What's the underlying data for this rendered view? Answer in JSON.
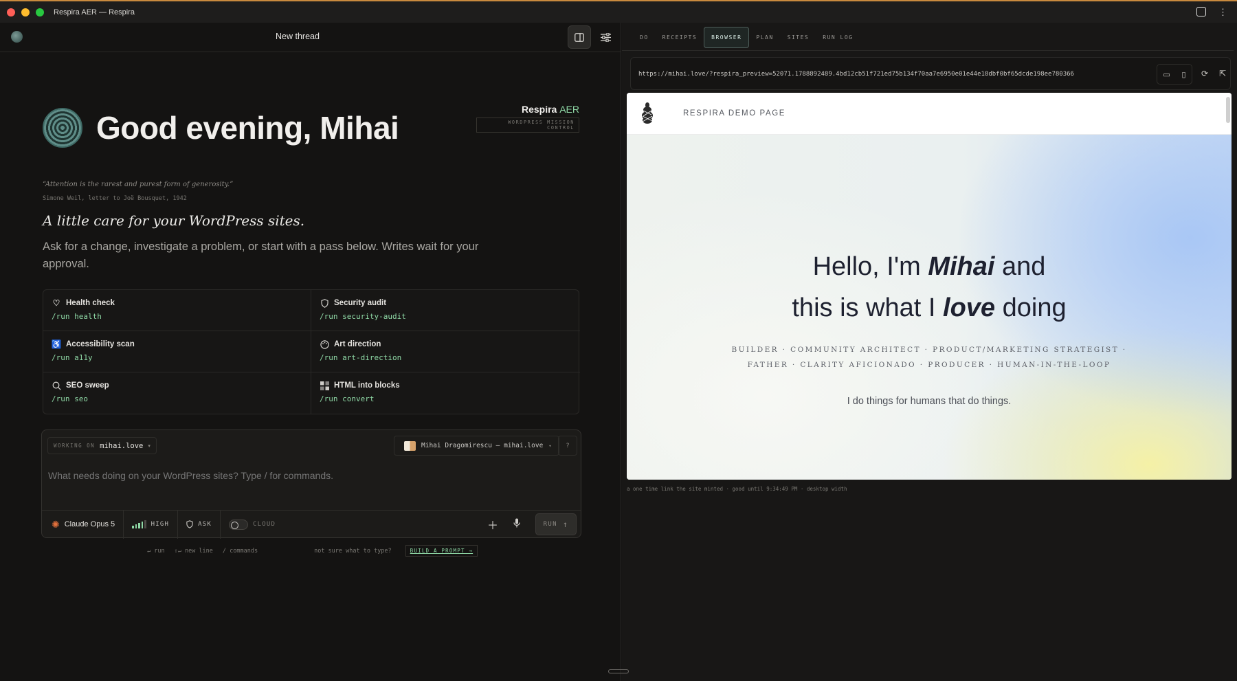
{
  "window": {
    "title": "Respira AER — Respira"
  },
  "left": {
    "thread_title": "New thread",
    "greeting": "Good evening, Mihai",
    "brand": {
      "name": "Respira",
      "suffix": "AER",
      "tagline": "WORDPRESS MISSION CONTROL"
    },
    "quote": "“Attention is the rarest and purest form of generosity.”",
    "attribution": "Simone Weil, letter to Joë Bousquet, 1942",
    "care_line": "A little care for your WordPress sites.",
    "lede": "Ask for a change, investigate a problem, or start with a pass below. Writes wait for your approval.",
    "cards": [
      {
        "title": "Health check",
        "command": "/run health",
        "icon": "heart-pulse-icon"
      },
      {
        "title": "Security audit",
        "command": "/run security-audit",
        "icon": "shield-icon"
      },
      {
        "title": "Accessibility scan",
        "command": "/run a11y",
        "icon": "accessibility-icon"
      },
      {
        "title": "Art direction",
        "command": "/run art-direction",
        "icon": "palette-icon"
      },
      {
        "title": "SEO sweep",
        "command": "/run seo",
        "icon": "search-icon"
      },
      {
        "title": "HTML into blocks",
        "command": "/run convert",
        "icon": "blocks-icon"
      }
    ],
    "composer": {
      "working_label": "WORKING ON",
      "working_value": "mihai.love",
      "account": "Mihai Dragomirescu — mihai.love",
      "help": "?",
      "placeholder": "What needs doing on your WordPress sites? Type / for commands.",
      "model": "Claude Opus 5",
      "effort": "HIGH",
      "mode": "ASK",
      "cloud": "CLOUD",
      "run": "RUN"
    },
    "hints": {
      "run": "↵ run",
      "newline": "⇧↵ new line",
      "commands": "/ commands",
      "unsure": "not sure what to type?",
      "build": "BUILD A PROMPT →"
    }
  },
  "right": {
    "tabs": [
      "DO",
      "RECEIPTS",
      "BROWSER",
      "PLAN",
      "SITES",
      "RUN LOG"
    ],
    "active_tab": "BROWSER",
    "url": "https://mihai.love/?respira_preview=52071.1788892489.4bd12cb51f721ed75b134f70aa7e6950e01e44e18dbf0bf65dcde198ee780366",
    "site": {
      "label": "RESPIRA DEMO PAGE",
      "hero_line1_a": "Hello, I'm ",
      "hero_line1_b": "Mihai",
      "hero_line1_c": " and",
      "hero_line2_a": "this is what I ",
      "hero_line2_b": "love",
      "hero_line2_c": " doing",
      "roles_1": "BUILDER  ·  COMMUNITY ARCHITECT  ·  PRODUCT/MARKETING STRATEGIST  ·",
      "roles_2": "FATHER  ·  CLARITY AFICIONADO  ·  PRODUCER  ·  HUMAN-IN-THE-LOOP",
      "tagline": "I do things for humans that do things."
    },
    "caption": "a one time link the site minted · good until 9:34:49 PM · desktop width"
  },
  "colors": {
    "accent": "#8fd9a6",
    "titlebar_border": "#c98a3e",
    "background": "#141312"
  }
}
